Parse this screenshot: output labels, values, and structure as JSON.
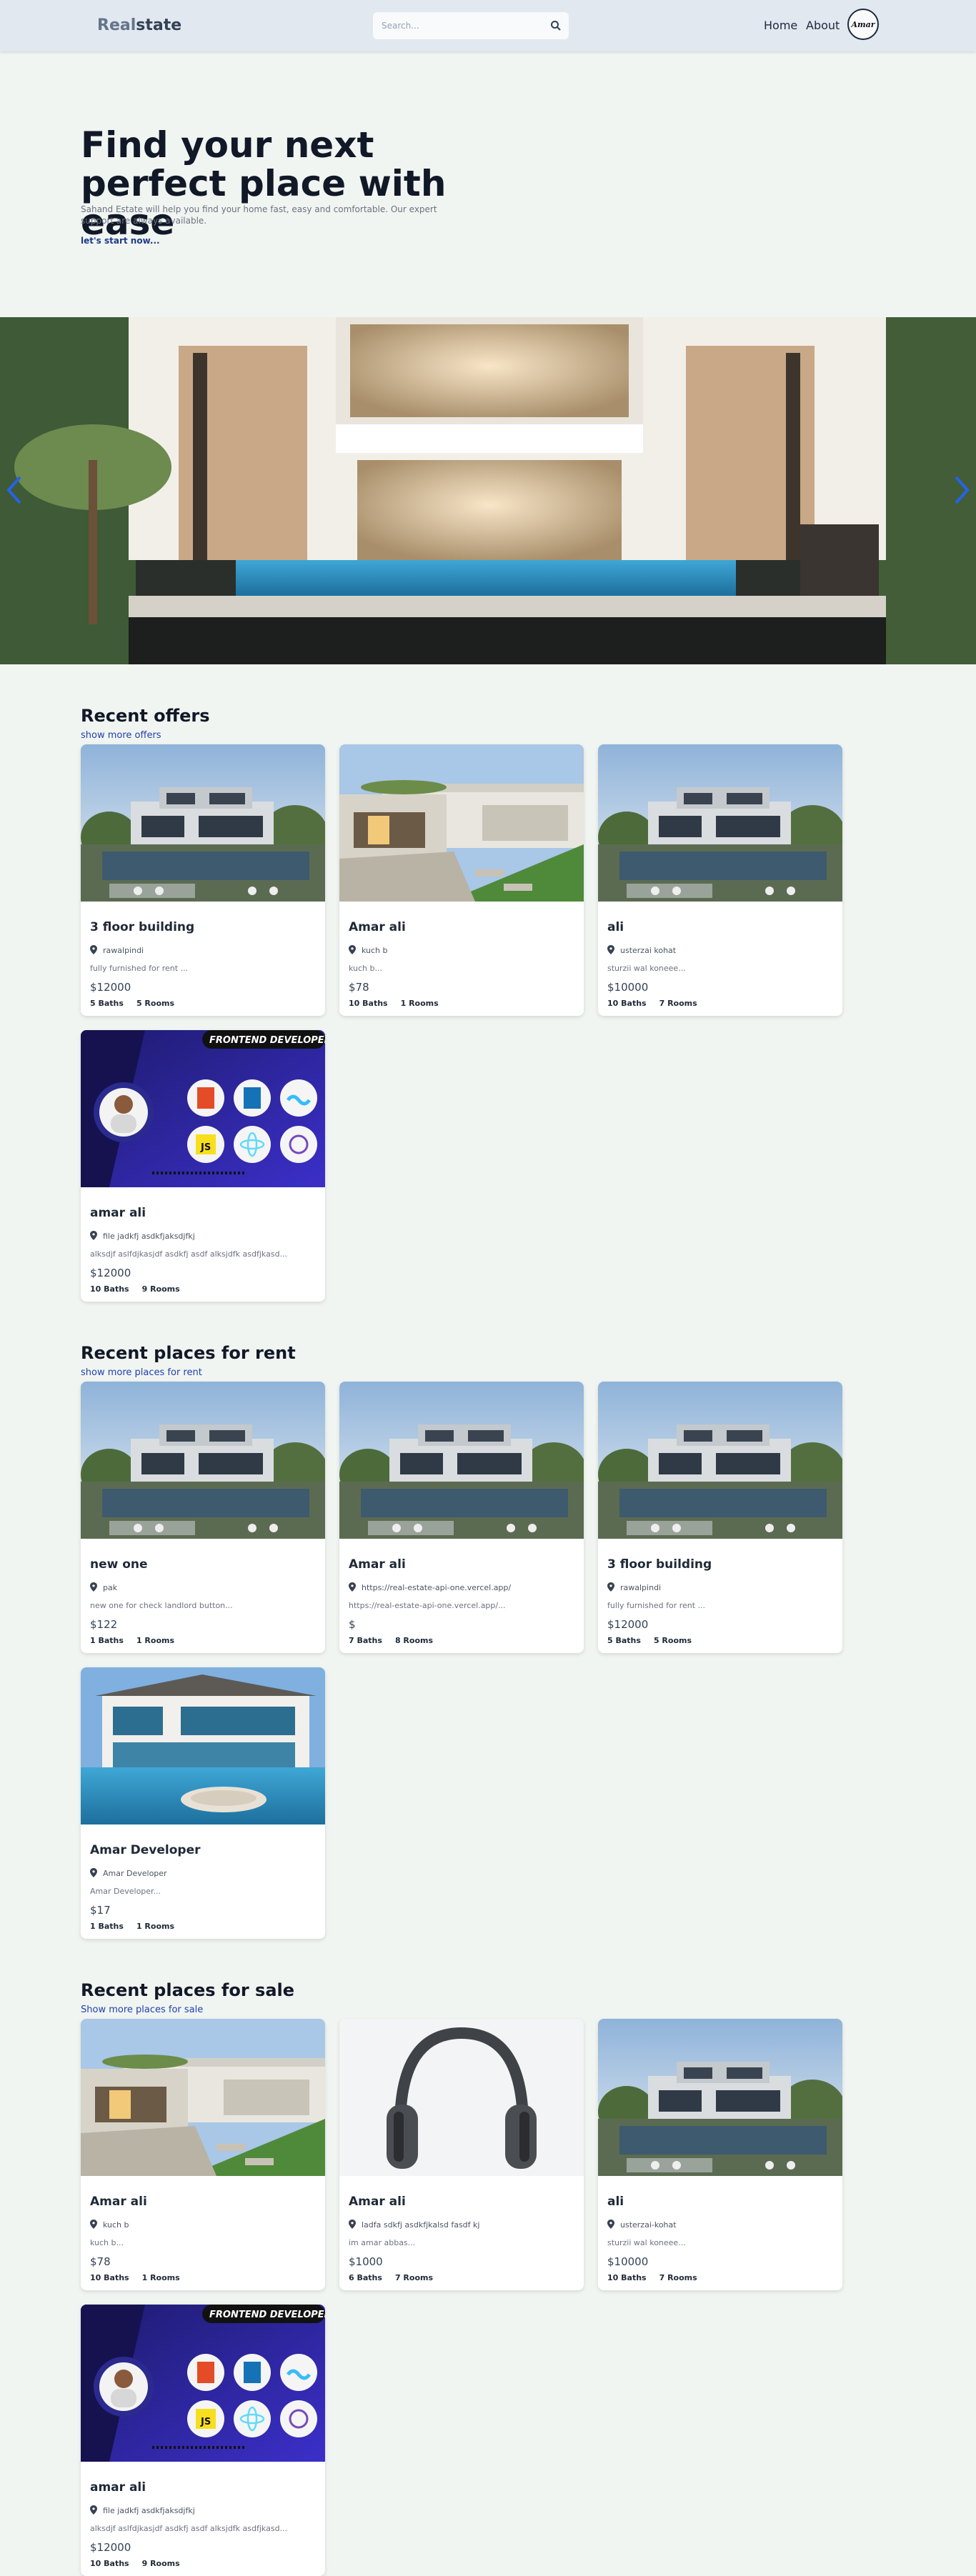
{
  "header": {
    "logo_part1": "Real",
    "logo_part2": "state",
    "search_placeholder": "Search...",
    "nav_home": "Home",
    "nav_about": "About",
    "avatar_text": "Amar"
  },
  "hero": {
    "title": "Find your next perfect place with ease",
    "description": "Sahand Estate will help you find your home fast, easy and comfortable. Our expert support are always available.",
    "link": "let's start now..."
  },
  "sections": {
    "offers": {
      "title": "Recent offers",
      "link": "show more offers"
    },
    "rent": {
      "title": "Recent places for rent",
      "link": "show more places for rent"
    },
    "sale": {
      "title": "Recent places for sale",
      "link": "Show more places for sale"
    }
  },
  "offers": [
    {
      "image": "modern-house",
      "title": "3 floor building",
      "address": "rawalpindi",
      "description": "fully furnished for rent ...",
      "price": "$12000",
      "baths": "5 Baths",
      "rooms": "5 Rooms"
    },
    {
      "image": "courtyard-house",
      "title": "Amar ali",
      "address": "kuch b",
      "description": "kuch b...",
      "price": "$78",
      "baths": "10 Baths",
      "rooms": "1 Rooms"
    },
    {
      "image": "modern-house",
      "title": "ali",
      "address": "usterzai kohat",
      "description": "sturzii wal koneee...",
      "price": "$10000",
      "baths": "10 Baths",
      "rooms": "7 Rooms"
    },
    {
      "image": "developer-banner",
      "title": "amar ali",
      "address": "file jadkfj asdkfjaksdjfkj",
      "description": "alksdjf aslfdjkasjdf asdkfj asdf alksjdfk asdfjkasd...",
      "price": "$12000",
      "baths": "10 Baths",
      "rooms": "9 Rooms"
    }
  ],
  "rent": [
    {
      "image": "modern-house",
      "title": "new one",
      "address": "pak",
      "description": "new one for check landlord button...",
      "price": "$122",
      "baths": "1 Baths",
      "rooms": "1 Rooms"
    },
    {
      "image": "modern-house",
      "title": "Amar ali",
      "address": "https://real-estate-api-one.vercel.app/",
      "description": "https://real-estate-api-one.vercel.app/...",
      "price": "$",
      "baths": "7 Baths",
      "rooms": "8 Rooms"
    },
    {
      "image": "modern-house",
      "title": "3 floor building",
      "address": "rawalpindi",
      "description": "fully furnished for rent ...",
      "price": "$12000",
      "baths": "5 Baths",
      "rooms": "5 Rooms"
    },
    {
      "image": "pool-house",
      "title": "Amar Developer",
      "address": "Amar Developer",
      "description": "Amar Developer...",
      "price": "$17",
      "baths": "1 Baths",
      "rooms": "1 Rooms"
    }
  ],
  "sale": [
    {
      "image": "courtyard-house",
      "title": "Amar ali",
      "address": "kuch b",
      "description": "kuch b...",
      "price": "$78",
      "baths": "10 Baths",
      "rooms": "1 Rooms"
    },
    {
      "image": "headphones",
      "title": "Amar ali",
      "address": "ladfa sdkfj asdkfjkalsd fasdf kj",
      "description": "im amar abbas...",
      "price": "$1000",
      "baths": "6 Baths",
      "rooms": "7 Rooms"
    },
    {
      "image": "modern-house",
      "title": "ali",
      "address": "usterzai-kohat",
      "description": "sturzii wal koneee...",
      "price": "$10000",
      "baths": "10 Baths",
      "rooms": "7 Rooms"
    },
    {
      "image": "developer-banner",
      "title": "amar ali",
      "address": "file jadkfj asdkfjaksdjfkj",
      "description": "alksdjf aslfdjkasjdf asdkfj asdf alksjdfk asdfjkasd...",
      "price": "$12000",
      "baths": "10 Baths",
      "rooms": "9 Rooms"
    }
  ],
  "banner": {
    "text": "FRONTEND DEVELOPER",
    "js": "JS"
  },
  "colors": {
    "accent": "#1e40af",
    "header_bg": "#e2e8f0",
    "page_bg": "#f1f5f1"
  }
}
